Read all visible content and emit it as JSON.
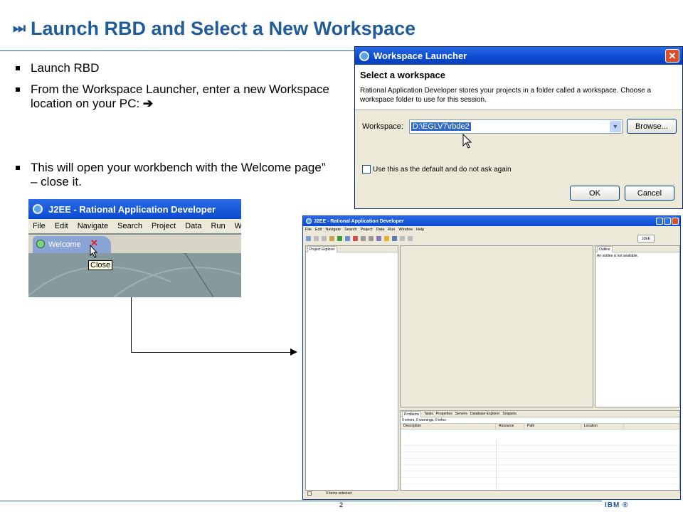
{
  "slide": {
    "title": "Launch RBD and Select a New Workspace",
    "title_icon": "⏭",
    "bullets": [
      {
        "text": "Launch RBD"
      },
      {
        "text": "From the Workspace Launcher, enter a new Workspace location on your PC:",
        "arrow": "➔"
      },
      {
        "text": "This will open your workbench with the Welcome page” – close it."
      }
    ],
    "page_number": "2",
    "logo_text": "IBM ®"
  },
  "workspace_dialog": {
    "title": "Workspace Launcher",
    "close_glyph": "✕",
    "heading": "Select a workspace",
    "description": "Rational Application Developer stores your projects in a folder called a workspace. Choose a workspace folder to use for this session.",
    "workspace_label": "Workspace:",
    "workspace_value": "D:\\EGLV7\\rbde2",
    "browse_label": "Browse...",
    "checkbox_label": "Use this as the default and do not ask again",
    "ok_label": "OK",
    "cancel_label": "Cancel"
  },
  "welcome_snippet": {
    "title": "J2EE - Rational Application Developer",
    "menu": [
      "File",
      "Edit",
      "Navigate",
      "Search",
      "Project",
      "Data",
      "Run",
      "Windo"
    ],
    "tab_label": "Welcome",
    "tab_close_glyph": "✕",
    "tooltip": "Close"
  },
  "ide_window": {
    "title": "J2EE - Rational Application Developer",
    "menu": [
      "File",
      "Edit",
      "Navigate",
      "Search",
      "Project",
      "Data",
      "Run",
      "Window",
      "Help"
    ],
    "perspective": "J2EE",
    "project_explorer_tab": "Project Explorer",
    "outline_tab": "Outline",
    "outline_message": "An outline is not available.",
    "bottom_tabs": [
      "Problems",
      "Tasks",
      "Properties",
      "Servers",
      "Database Explorer",
      "Snippets"
    ],
    "problems_summary": "0 errors, 0 warnings, 0 infos",
    "columns": [
      "Description",
      "Resource",
      "Path",
      "Location"
    ],
    "status_text": "0 items selected"
  },
  "colors": {
    "title_blue": "#1f5c99",
    "xp_title_blue": "#0b4ad0"
  }
}
